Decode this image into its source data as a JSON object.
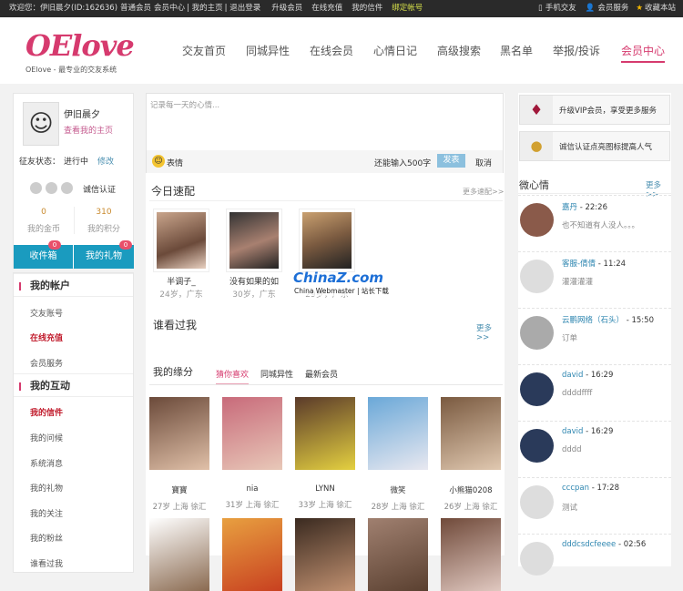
{
  "topbar": {
    "welcome": "欢迎您：",
    "user": "伊旧晨夕(ID:162636)",
    "level": "普通会员",
    "links": [
      "会员中心",
      "我的主页",
      "退出登录"
    ],
    "upgrade": "升级会员",
    "recharge": "在线充值",
    "mail": "我的信件",
    "bind": "绑定帐号",
    "mobile": "手机交友",
    "service": "会员服务",
    "favorite": "收藏本站"
  },
  "header": {
    "logo": "OElove",
    "slogan": "OElove - 最专业的交友系统",
    "nav": [
      "交友首页",
      "同城异性",
      "在线会员",
      "心情日记",
      "高级搜索",
      "黑名单",
      "举报/投诉",
      "会员中心"
    ]
  },
  "profile": {
    "name": "伊旧晨夕",
    "view_home": "查看我的主页",
    "status_label": "征友状态：",
    "status": "进行中",
    "edit": "修改",
    "cert": "诚信认证",
    "coins": "0",
    "coins_label": "我的金币",
    "points": "310",
    "points_label": "我的积分",
    "inbox": "收件箱",
    "inbox_count": "0",
    "gifts": "我的礼物",
    "gifts_count": "0"
  },
  "menu": {
    "account": {
      "title": "我的帐户",
      "items": [
        "交友账号",
        "在线充值",
        "会员服务"
      ]
    },
    "interact": {
      "title": "我的互动",
      "items": [
        "我的信件",
        "我的问候",
        "系统消息",
        "我的礼物",
        "我的关注",
        "我的粉丝",
        "谁看过我"
      ]
    }
  },
  "post": {
    "placeholder": "记录每一天的心情...",
    "emoji": "表情",
    "remaining": "还能输入500字",
    "publish": "发表",
    "cancel": "取消"
  },
  "speed": {
    "title": "今日速配",
    "more": "更多速配>>",
    "people": [
      {
        "name": "半调子_",
        "info": "24岁，广东"
      },
      {
        "name": "没有如果的如",
        "info": "30岁，广东"
      },
      {
        "name": "",
        "info": "29岁，广东"
      }
    ]
  },
  "watermark": {
    "logo": "ChinaZ.com",
    "sub": "China Webmaster | 站长下载"
  },
  "visitors": {
    "title": "谁看过我",
    "more": "更多>>"
  },
  "fate": {
    "title": "我的缘分",
    "tabs": [
      "猜你喜欢",
      "同城异性",
      "最新会员"
    ],
    "people": [
      {
        "name": "寶寶",
        "info": "27岁 上海 徐汇"
      },
      {
        "name": "nia",
        "info": "31岁 上海 徐汇"
      },
      {
        "name": "LYNN",
        "info": "33岁 上海 徐汇"
      },
      {
        "name": "微笑",
        "info": "28岁 上海 徐汇"
      },
      {
        "name": "小熊猫0208",
        "info": "26岁 上海 徐汇"
      }
    ]
  },
  "promo": {
    "vip": "升级VIP会员，享受更多服务",
    "cert": "诚信认证点亮图标提高人气"
  },
  "moods": {
    "title": "微心情",
    "more": "更多>>",
    "items": [
      {
        "user": "嘉丹",
        "time": " - 22:26",
        "text": "也不知道有人没人。。。"
      },
      {
        "user": "客服-倩倩",
        "time": " - 11:24",
        "text": "灌灌灌灌"
      },
      {
        "user": "云鹏网络（石头）",
        "time": " - 15:50",
        "text": "订单"
      },
      {
        "user": "david",
        "time": " - 16:29",
        "text": "ddddffff"
      },
      {
        "user": "david",
        "time": " - 16:29",
        "text": "dddd"
      },
      {
        "user": "cccpan",
        "time": " - 17:28",
        "text": "测试"
      },
      {
        "user": "dddcsdcfeeee",
        "time": " - 02:56",
        "text": ""
      }
    ]
  },
  "colors": {
    "accent": "#d63a6e",
    "teal": "#1a9bbf",
    "topbar": "#2a2a2a"
  }
}
